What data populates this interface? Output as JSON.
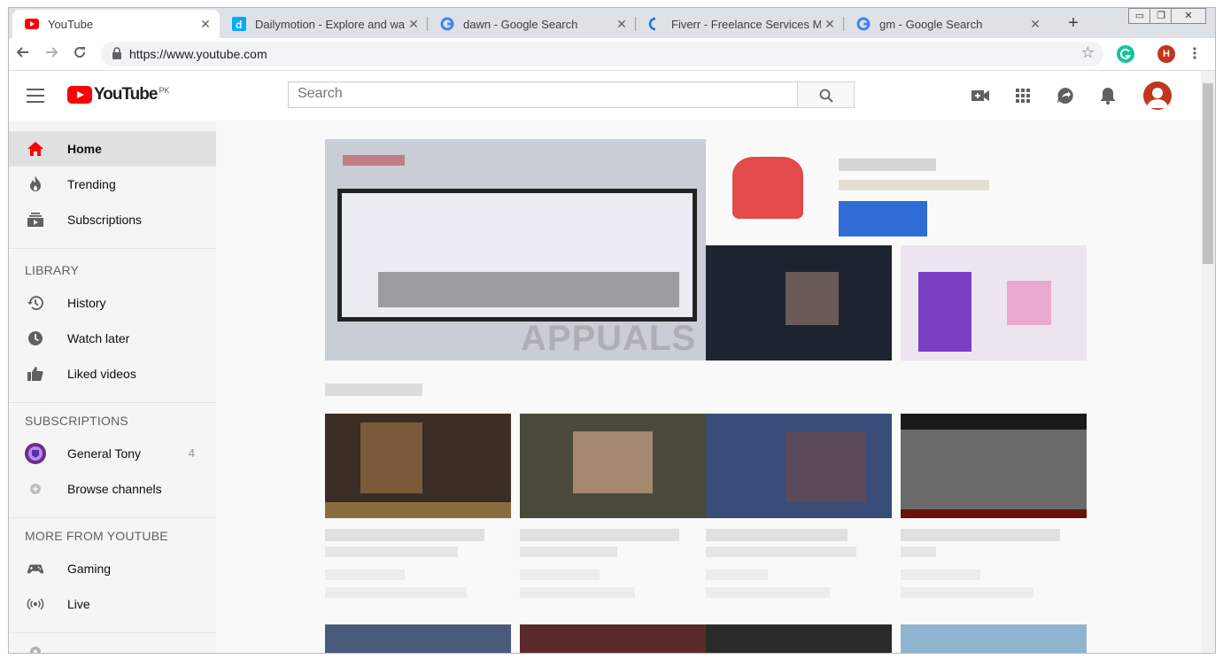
{
  "browser": {
    "tabs": [
      {
        "title": "YouTube",
        "active": true
      },
      {
        "title": "Dailymotion - Explore and watch",
        "active": false
      },
      {
        "title": "dawn - Google Search",
        "active": false
      },
      {
        "title": "Fiverr - Freelance Services Mark",
        "active": false
      },
      {
        "title": "gm - Google Search",
        "active": false
      }
    ],
    "url": "https://www.youtube.com",
    "profile_initial": "H",
    "window_controls": [
      "▭",
      "❐",
      "✕"
    ]
  },
  "youtube": {
    "logo_text": "YouTube",
    "country_code": "PK",
    "search_placeholder": "Search"
  },
  "sidebar": {
    "main": [
      {
        "label": "Home",
        "selected": true
      },
      {
        "label": "Trending"
      },
      {
        "label": "Subscriptions"
      }
    ],
    "library_heading": "LIBRARY",
    "library": [
      {
        "label": "History"
      },
      {
        "label": "Watch later"
      },
      {
        "label": "Liked videos"
      }
    ],
    "subscriptions_heading": "SUBSCRIPTIONS",
    "subscriptions": [
      {
        "label": "General Tony",
        "count": "4"
      },
      {
        "label": "Browse channels"
      }
    ],
    "more_heading": "MORE FROM YOUTUBE",
    "more": [
      {
        "label": "Gaming"
      },
      {
        "label": "Live"
      }
    ]
  },
  "watermark": "APPUALS",
  "colors": {
    "youtube_red": "#ff0000",
    "avatar": "#c1361d",
    "tab_strip": "#dee1e6"
  }
}
